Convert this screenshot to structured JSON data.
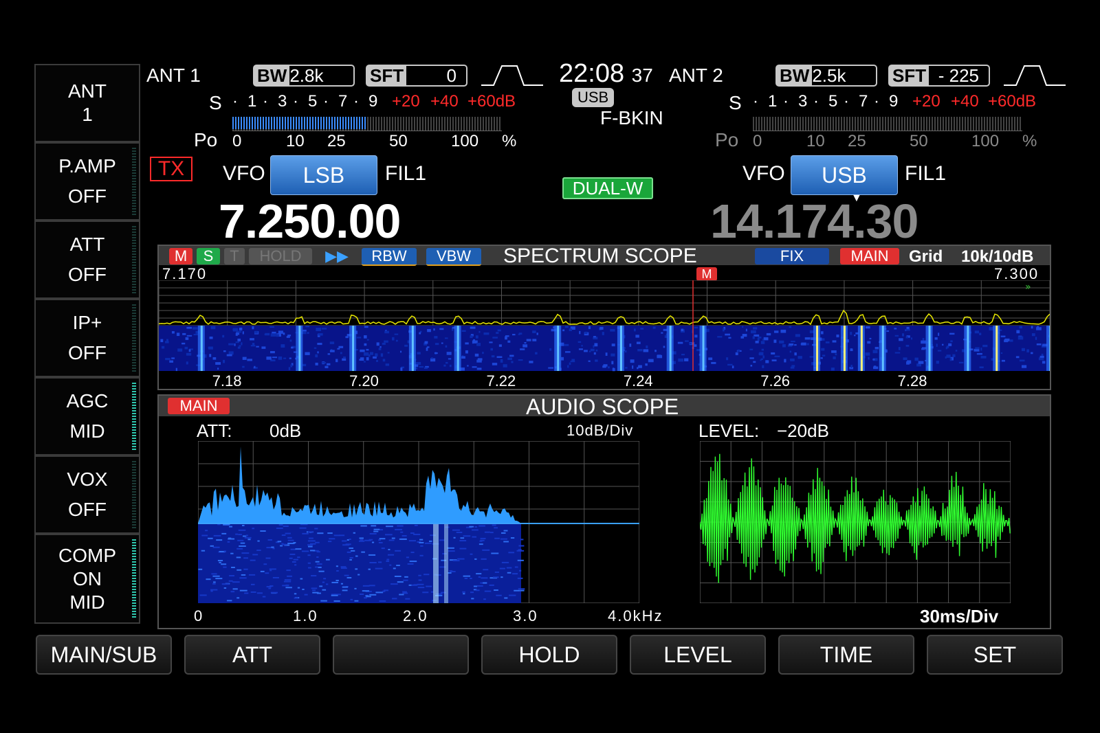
{
  "side_menu": [
    {
      "line1": "ANT",
      "line2": "1"
    },
    {
      "line1": "P.AMP",
      "line2": "OFF"
    },
    {
      "line1": "ATT",
      "line2": "OFF"
    },
    {
      "line1": "IP+",
      "line2": "OFF"
    },
    {
      "line1": "AGC",
      "line2": "MID"
    },
    {
      "line1": "VOX",
      "line2": "OFF"
    },
    {
      "line1": "COMP",
      "line2": "ON",
      "line3": "MID"
    }
  ],
  "clock": {
    "hhmm": "22:08",
    "sec": "37"
  },
  "mode_badge": "USB",
  "break_in": "F-BKIN",
  "dual_watch": "DUAL-W",
  "main": {
    "ant": "ANT 1",
    "bw_key": "BW",
    "bw_val": "2.8k",
    "sft_key": "SFT",
    "sft_val": "0",
    "tx": "TX",
    "vfo": "VFO",
    "mode": "LSB",
    "filter": "FIL1",
    "freq": "7.250.00",
    "s_label": "S",
    "po_label": "Po",
    "s_scale": [
      "1",
      "3",
      "5",
      "7",
      "9"
    ],
    "s_over": [
      "+20",
      "+40",
      "+60dB"
    ],
    "po_scale": [
      "0",
      "10",
      "25",
      "50",
      "100",
      "%"
    ],
    "po_level": 0.5
  },
  "sub": {
    "ant": "ANT 2",
    "bw_key": "BW",
    "bw_val": "2.5k",
    "sft_key": "SFT",
    "sft_val": "- 225",
    "vfo": "VFO",
    "mode": "USB",
    "filter": "FIL1",
    "freq": "14.174.30",
    "s_label": "S",
    "po_label": "Po",
    "s_scale": [
      "1",
      "3",
      "5",
      "7",
      "9"
    ],
    "s_over": [
      "+20",
      "+40",
      "+60dB"
    ],
    "po_scale": [
      "0",
      "10",
      "25",
      "50",
      "100",
      "%"
    ]
  },
  "spectrum": {
    "tags": {
      "m": "M",
      "s": "S",
      "t": "T",
      "hold": "HOLD",
      "ff": "▶▶",
      "rbw": "RBW",
      "vbw": "VBW",
      "fix": "FIX",
      "main": "MAIN"
    },
    "title": "SPECTRUM SCOPE",
    "grid_label": "Grid",
    "grid_val": "10k/10dB",
    "start": "7.170",
    "end": "7.300",
    "marker": "M",
    "ticks": [
      "7.18",
      "7.20",
      "7.22",
      "7.24",
      "7.26",
      "7.28"
    ]
  },
  "audio": {
    "tag": "MAIN",
    "title": "AUDIO SCOPE",
    "att_label": "ATT:",
    "att_val": "0dB",
    "fft_div": "10dB/Div",
    "level_label": "LEVEL:",
    "level_val": "−20dB",
    "fft_ticks": [
      "0",
      "1.0",
      "2.0",
      "3.0",
      "4.0kHz"
    ],
    "osc_div": "30ms/Div"
  },
  "bottom_bar": [
    "MAIN/SUB",
    "ATT",
    "",
    "HOLD",
    "LEVEL",
    "TIME",
    "SET"
  ],
  "colors": {
    "accent": "#1e5fb3",
    "trace": "#e8e800",
    "fft": "#2f9cff",
    "osc": "#30ff30",
    "tx": "#ff2a2a",
    "dualw": "#1aa63a"
  }
}
